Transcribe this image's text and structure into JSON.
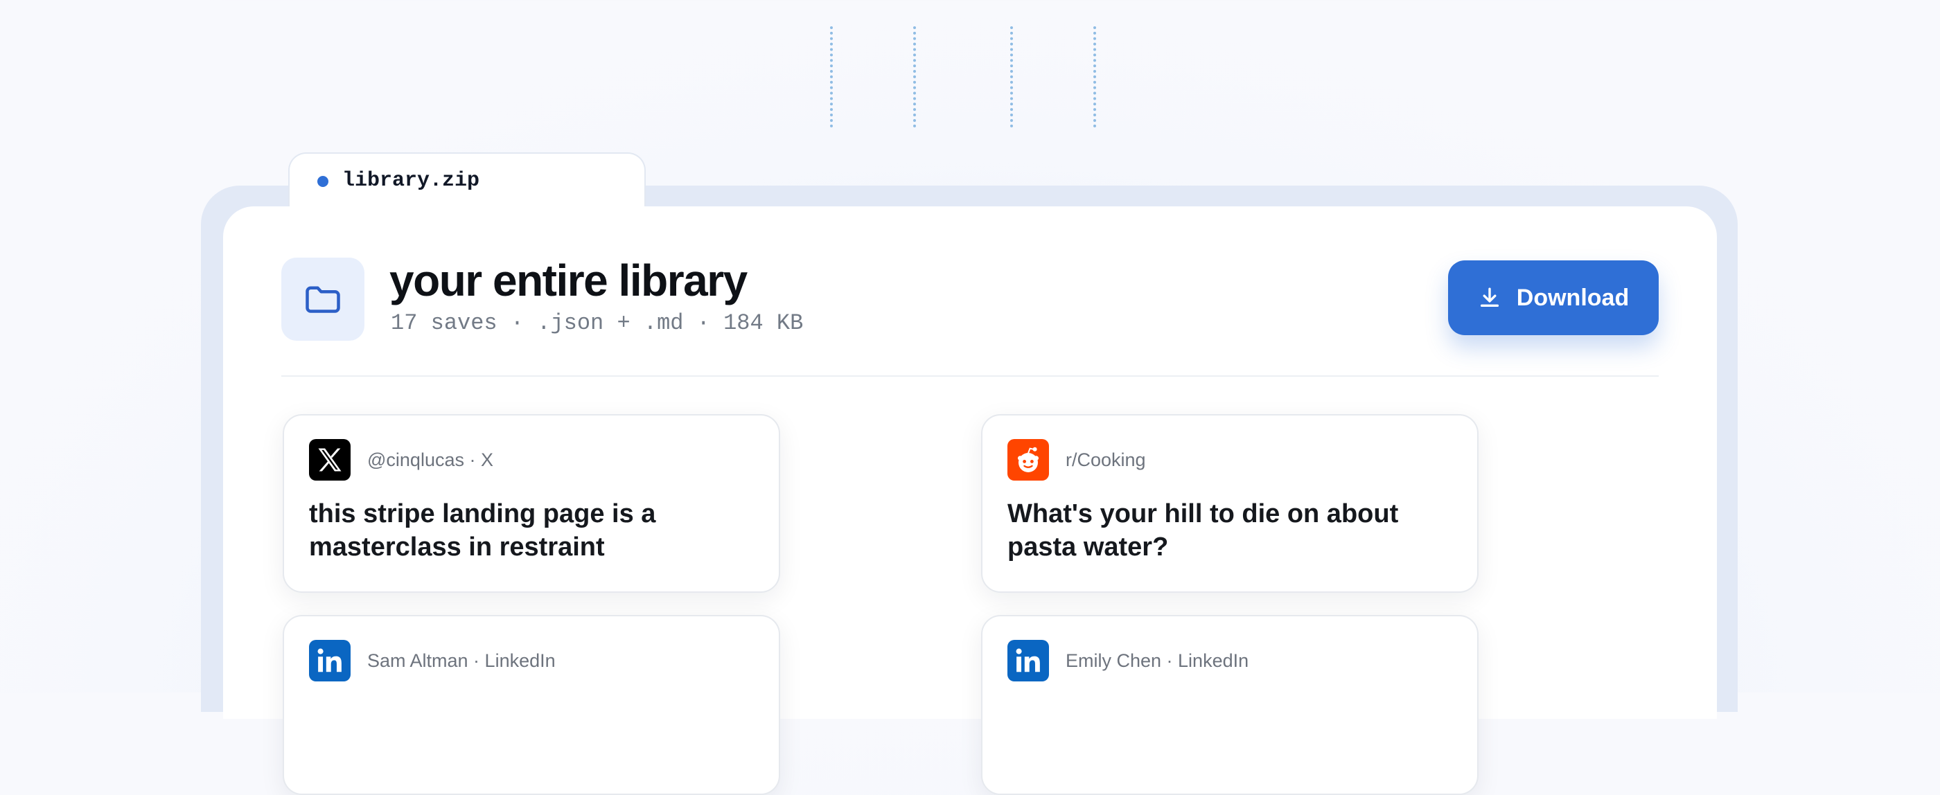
{
  "archive": {
    "filename": "library.zip"
  },
  "library": {
    "title": "your entire library",
    "meta": "17 saves · .json + .md · 184 KB",
    "download_label": "Download"
  },
  "posts": [
    {
      "icon": "x-logo-icon",
      "source": "@cinqlucas · X",
      "text": "this stripe landing page is a masterclass in restraint"
    },
    {
      "icon": "reddit-logo-icon",
      "source": "r/Cooking",
      "text": "What's your hill to die on about pasta water?"
    },
    {
      "icon": "linkedin-logo-icon",
      "source": "Sam Altman · LinkedIn",
      "text": ""
    },
    {
      "icon": "linkedin-logo-icon",
      "source": "Emily Chen · LinkedIn",
      "text": ""
    }
  ],
  "colors": {
    "accent": "#2f6fd6",
    "reddit": "#ff4500",
    "linkedin": "#0a66c2",
    "x": "#000000"
  }
}
